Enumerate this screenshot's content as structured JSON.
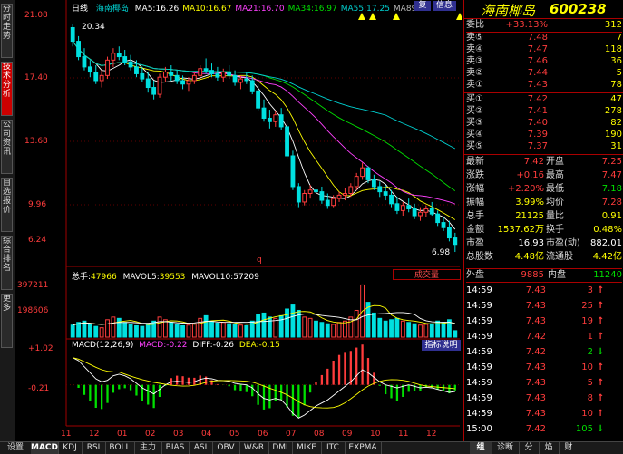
{
  "sidebar_tabs": [
    {
      "label": "分时走势",
      "active": false
    },
    {
      "label": "技术分析",
      "active": true
    },
    {
      "label": "公司资讯",
      "active": false
    },
    {
      "label": "自选报价",
      "active": false
    },
    {
      "label": "综合排名",
      "active": false
    },
    {
      "label": "更多",
      "active": false
    }
  ],
  "chart": {
    "period": "日线",
    "stock_name": "海南椰岛",
    "ma": [
      {
        "label": "MA5:",
        "value": "16.26",
        "color": "#ffffff"
      },
      {
        "label": "MA10:",
        "value": "16.67",
        "color": "#ffff00"
      },
      {
        "label": "MA21:",
        "value": "16.70",
        "color": "#ff40ff"
      },
      {
        "label": "MA34:",
        "value": "16.97",
        "color": "#00e000"
      },
      {
        "label": "MA55:",
        "value": "17.25",
        "color": "#00d0d0"
      },
      {
        "label": "MA89:",
        "value": "",
        "color": "#bbbbbb"
      }
    ],
    "buttons": {
      "fuquan": "复",
      "info": "信息"
    },
    "y_labels": [
      "21.08",
      "17.40",
      "13.68",
      "9.96",
      "6.24"
    ],
    "high_label": "20.34",
    "low_label": "6.98",
    "q_marker": "q",
    "vol_header": {
      "label": "总手:",
      "value": "47966",
      "mavol5_label": "MAVOL5:",
      "mavol5": "39553",
      "mavol10_label": "MAVOL10:",
      "mavol10": "57209",
      "dropdown": "成交量"
    },
    "vol_y": [
      "397211",
      "198606"
    ],
    "macd_header": {
      "label": "MACD(12,26,9)",
      "macd_label": "MACD:",
      "macd": "-0.22",
      "diff_label": "DIFF:",
      "diff": "-0.26",
      "dea_label": "DEA:",
      "dea": "-0.15",
      "guide": "指标说明"
    },
    "macd_y": [
      "+1.02",
      "-0.21"
    ],
    "x_labels": [
      "11",
      "12",
      "01",
      "02",
      "03",
      "04",
      "05",
      "06",
      "07",
      "08",
      "09",
      "10",
      "11",
      "12"
    ]
  },
  "chart_data": {
    "type": "candlestick",
    "price_ylim": [
      6.24,
      21.08
    ],
    "highest": 20.34,
    "lowest": 6.98,
    "candles": [
      [
        20.1,
        20.3,
        19.0,
        19.3
      ],
      [
        19.3,
        19.6,
        18.2,
        18.4
      ],
      [
        18.4,
        18.9,
        17.6,
        17.8
      ],
      [
        17.8,
        18.2,
        17.2,
        17.5
      ],
      [
        17.5,
        17.9,
        16.8,
        17.0
      ],
      [
        17.0,
        17.6,
        16.6,
        17.3
      ],
      [
        17.3,
        18.4,
        17.1,
        18.2
      ],
      [
        18.2,
        18.9,
        17.8,
        18.6
      ],
      [
        18.6,
        19.0,
        18.2,
        18.4
      ],
      [
        18.4,
        18.8,
        17.9,
        18.1
      ],
      [
        18.1,
        18.5,
        17.6,
        17.8
      ],
      [
        17.8,
        18.2,
        17.2,
        17.4
      ],
      [
        17.4,
        17.8,
        16.9,
        17.1
      ],
      [
        17.1,
        17.5,
        16.3,
        16.6
      ],
      [
        16.6,
        17.0,
        15.9,
        16.2
      ],
      [
        16.2,
        17.4,
        16.0,
        17.2
      ],
      [
        17.2,
        17.8,
        16.9,
        17.5
      ],
      [
        17.5,
        17.9,
        17.0,
        17.3
      ],
      [
        17.3,
        17.6,
        16.8,
        17.0
      ],
      [
        17.0,
        17.3,
        16.5,
        16.8
      ],
      [
        16.8,
        17.2,
        16.4,
        17.0
      ],
      [
        17.0,
        17.5,
        16.8,
        17.3
      ],
      [
        17.3,
        17.9,
        17.1,
        17.7
      ],
      [
        17.7,
        18.3,
        17.4,
        17.6
      ],
      [
        17.6,
        18.0,
        17.2,
        17.4
      ],
      [
        17.4,
        17.8,
        17.0,
        17.2
      ],
      [
        17.2,
        17.7,
        16.9,
        17.5
      ],
      [
        17.5,
        17.9,
        17.1,
        17.3
      ],
      [
        17.3,
        17.6,
        16.7,
        16.9
      ],
      [
        16.9,
        17.3,
        16.5,
        17.1
      ],
      [
        17.1,
        17.5,
        16.8,
        17.0
      ],
      [
        17.0,
        17.3,
        16.2,
        16.4
      ],
      [
        16.4,
        16.8,
        15.2,
        15.4
      ],
      [
        15.4,
        15.9,
        14.6,
        14.8
      ],
      [
        14.8,
        15.3,
        14.2,
        14.6
      ],
      [
        14.6,
        15.2,
        14.3,
        15.0
      ],
      [
        15.0,
        15.4,
        14.1,
        14.3
      ],
      [
        14.3,
        14.7,
        12.4,
        12.6
      ],
      [
        12.6,
        12.9,
        10.6,
        10.8
      ],
      [
        10.8,
        11.0,
        9.6,
        9.9
      ],
      [
        9.9,
        10.6,
        9.7,
        10.4
      ],
      [
        10.4,
        10.9,
        10.1,
        10.6
      ],
      [
        10.6,
        11.2,
        10.3,
        10.5
      ],
      [
        10.5,
        10.8,
        9.8,
        10.0
      ],
      [
        10.0,
        10.4,
        9.5,
        9.7
      ],
      [
        9.7,
        10.3,
        9.6,
        10.1
      ],
      [
        10.1,
        10.5,
        9.9,
        10.3
      ],
      [
        10.3,
        10.7,
        10.0,
        10.4
      ],
      [
        10.4,
        11.0,
        10.2,
        10.8
      ],
      [
        10.8,
        11.6,
        10.6,
        11.4
      ],
      [
        11.4,
        12.2,
        11.2,
        11.9
      ],
      [
        11.9,
        12.0,
        11.0,
        11.2
      ],
      [
        11.2,
        11.5,
        10.6,
        10.8
      ],
      [
        10.8,
        11.1,
        10.2,
        10.5
      ],
      [
        10.5,
        10.9,
        10.0,
        10.3
      ],
      [
        10.3,
        10.6,
        9.6,
        9.8
      ],
      [
        9.8,
        10.2,
        9.2,
        9.4
      ],
      [
        9.4,
        9.9,
        9.1,
        9.7
      ],
      [
        9.7,
        10.1,
        9.3,
        9.5
      ],
      [
        9.5,
        9.8,
        8.9,
        9.1
      ],
      [
        9.1,
        9.6,
        8.8,
        9.3
      ],
      [
        9.3,
        9.7,
        9.0,
        9.5
      ],
      [
        9.5,
        9.9,
        9.1,
        9.2
      ],
      [
        9.2,
        9.4,
        8.5,
        8.7
      ],
      [
        8.7,
        9.0,
        8.2,
        8.4
      ],
      [
        8.4,
        8.8,
        7.6,
        7.8
      ],
      [
        7.8,
        8.1,
        6.98,
        7.42
      ]
    ],
    "volume_ylim": [
      0,
      420000
    ],
    "volume": [
      90,
      110,
      120,
      95,
      80,
      70,
      130,
      150,
      140,
      110,
      95,
      85,
      80,
      100,
      120,
      150,
      130,
      110,
      95,
      85,
      90,
      100,
      140,
      160,
      120,
      105,
      110,
      100,
      95,
      90,
      85,
      120,
      170,
      180,
      150,
      140,
      160,
      210,
      240,
      200,
      150,
      140,
      120,
      110,
      100,
      95,
      110,
      120,
      150,
      200,
      390,
      260,
      180,
      140,
      120,
      130,
      140,
      120,
      110,
      100,
      90,
      95,
      100,
      120,
      110,
      130,
      48
    ],
    "macd_ylim": [
      -1.3,
      1.1
    ],
    "macd": [
      0.9,
      0.8,
      0.6,
      0.4,
      0.2,
      0.1,
      0.15,
      0.3,
      0.35,
      0.3,
      0.2,
      0.05,
      -0.1,
      -0.2,
      -0.3,
      -0.15,
      0.0,
      0.1,
      0.12,
      0.1,
      0.08,
      0.1,
      0.18,
      0.22,
      0.2,
      0.15,
      0.14,
      0.12,
      0.05,
      0.02,
      0.0,
      -0.1,
      -0.3,
      -0.45,
      -0.5,
      -0.45,
      -0.5,
      -0.7,
      -0.95,
      -1.1,
      -1.0,
      -0.85,
      -0.7,
      -0.6,
      -0.5,
      -0.35,
      -0.2,
      -0.05,
      0.1,
      0.3,
      0.5,
      0.4,
      0.25,
      0.1,
      0.0,
      -0.05,
      -0.1,
      -0.05,
      0.0,
      -0.05,
      -0.1,
      -0.08,
      -0.1,
      -0.15,
      -0.2,
      -0.25,
      -0.22
    ]
  },
  "quote": {
    "title_name": "海南椰岛",
    "title_code": "600238",
    "weibi": {
      "label": "委比",
      "value": "+33.13%",
      "vol": "312"
    },
    "sells": [
      {
        "label": "卖⑤",
        "price": "7.48",
        "vol": "7"
      },
      {
        "label": "卖④",
        "price": "7.47",
        "vol": "118"
      },
      {
        "label": "卖③",
        "price": "7.46",
        "vol": "36"
      },
      {
        "label": "卖②",
        "price": "7.44",
        "vol": "5"
      },
      {
        "label": "卖①",
        "price": "7.43",
        "vol": "78"
      }
    ],
    "buys": [
      {
        "label": "买①",
        "price": "7.42",
        "vol": "47"
      },
      {
        "label": "买②",
        "price": "7.41",
        "vol": "278"
      },
      {
        "label": "买③",
        "price": "7.40",
        "vol": "82"
      },
      {
        "label": "买④",
        "price": "7.39",
        "vol": "190"
      },
      {
        "label": "买⑤",
        "price": "7.37",
        "vol": "31"
      }
    ],
    "stats": [
      {
        "l1": "最新",
        "v1": "7.42",
        "c1": "red",
        "l2": "开盘",
        "v2": "7.25",
        "c2": "red"
      },
      {
        "l1": "涨跌",
        "v1": "+0.16",
        "c1": "red",
        "l2": "最高",
        "v2": "7.47",
        "c2": "red"
      },
      {
        "l1": "涨幅",
        "v1": "+2.20%",
        "c1": "red",
        "l2": "最低",
        "v2": "7.18",
        "c2": "grn"
      },
      {
        "l1": "振幅",
        "v1": "3.99%",
        "c1": "yel",
        "l2": "均价",
        "v2": "7.28",
        "c2": "red"
      },
      {
        "l1": "总手",
        "v1": "21125",
        "c1": "yel",
        "l2": "量比",
        "v2": "0.91",
        "c2": "yel"
      },
      {
        "l1": "金额",
        "v1": "1537.62万",
        "c1": "yel",
        "l2": "换手",
        "v2": "0.48%",
        "c2": "yel"
      },
      {
        "l1": "市盈",
        "v1": "16.93",
        "c1": "wht",
        "l2": "市盈(动)",
        "v2": "882.01",
        "c2": "wht"
      },
      {
        "l1": "总股数",
        "v1": "4.48亿",
        "c1": "yel",
        "l2": "流通股",
        "v2": "4.42亿",
        "c2": "yel"
      }
    ],
    "outer": {
      "label": "外盘",
      "value": "9885",
      "inner_label": "内盘",
      "inner_value": "11240"
    },
    "ticks": [
      {
        "time": "14:59",
        "price": "7.43",
        "vol": "3",
        "dir": "up"
      },
      {
        "time": "14:59",
        "price": "7.43",
        "vol": "25",
        "dir": "up"
      },
      {
        "time": "14:59",
        "price": "7.43",
        "vol": "19",
        "dir": "up"
      },
      {
        "time": "14:59",
        "price": "7.42",
        "vol": "1",
        "dir": "up"
      },
      {
        "time": "14:59",
        "price": "7.42",
        "vol": "2",
        "dir": "down"
      },
      {
        "time": "14:59",
        "price": "7.43",
        "vol": "10",
        "dir": "up"
      },
      {
        "time": "14:59",
        "price": "7.43",
        "vol": "5",
        "dir": "up"
      },
      {
        "time": "14:59",
        "price": "7.43",
        "vol": "8",
        "dir": "up"
      },
      {
        "time": "14:59",
        "price": "7.43",
        "vol": "10",
        "dir": "up"
      },
      {
        "time": "15:00",
        "price": "7.42",
        "vol": "105",
        "dir": "down"
      }
    ]
  },
  "bottom_tabs": [
    {
      "label": "设置",
      "active": false
    },
    {
      "label": "MACD",
      "active": true
    },
    {
      "label": "KDJ",
      "active": false
    },
    {
      "label": "RSI",
      "active": false
    },
    {
      "label": "BOLL",
      "active": false
    },
    {
      "label": "主力",
      "active": false
    },
    {
      "label": "BIAS",
      "active": false
    },
    {
      "label": "ASI",
      "active": false
    },
    {
      "label": "OBV",
      "active": false
    },
    {
      "label": "W&R",
      "active": false
    },
    {
      "label": "DMI",
      "active": false
    },
    {
      "label": "MIKE",
      "active": false
    },
    {
      "label": "ITC",
      "active": false
    },
    {
      "label": "EXPMA",
      "active": false
    },
    {
      "label": "组",
      "active": true
    },
    {
      "label": "诊断",
      "active": false
    },
    {
      "label": "分",
      "active": false
    },
    {
      "label": "焰",
      "active": false
    },
    {
      "label": "财",
      "active": false
    }
  ],
  "colors": {
    "up": "#ff3c3c",
    "down": "#00e0e0",
    "grid": "#a00000",
    "bg": "#000000"
  }
}
